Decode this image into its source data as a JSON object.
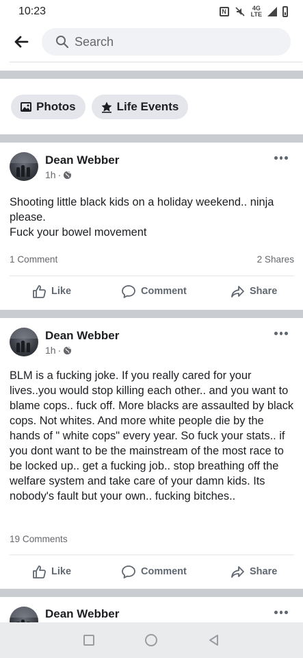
{
  "status_bar": {
    "time": "10:23",
    "network": "4G LTE"
  },
  "search": {
    "placeholder": "Search"
  },
  "chips": [
    {
      "label": "Photos",
      "icon": "photos-icon"
    },
    {
      "label": "Life Events",
      "icon": "star-icon"
    }
  ],
  "posts": [
    {
      "author": "Dean Webber",
      "time": "1h",
      "audience_icon": "globe-icon",
      "text": "Shooting little black kids on a holiday weekend.. ninja please.\nFuck your bowel movement",
      "comments": "1 Comment",
      "shares": "2 Shares"
    },
    {
      "author": "Dean Webber",
      "time": "1h",
      "audience_icon": "globe-icon",
      "text": "BLM is a fucking joke. If you really cared for your lives..you would stop killing each other.. and you want to blame cops.. fuck off. More blacks are assaulted by black cops. Not whites. And more white people die by the hands of \" white cops\" every year. So fuck your stats.. if you dont want to be the mainstream of the most race to be locked up.. get a fucking job.. stop breathing off the welfare system and take care of your damn kids. Its nobody's fault but your own.. fucking bitches..",
      "comments": "19 Comments",
      "shares": ""
    },
    {
      "author": "Dean Webber"
    }
  ],
  "actions": {
    "like": "Like",
    "comment": "Comment",
    "share": "Share"
  },
  "colors": {
    "divider": "#c9ccd1",
    "secondary_text": "#65676b",
    "chip_bg": "#e4e6eb"
  }
}
